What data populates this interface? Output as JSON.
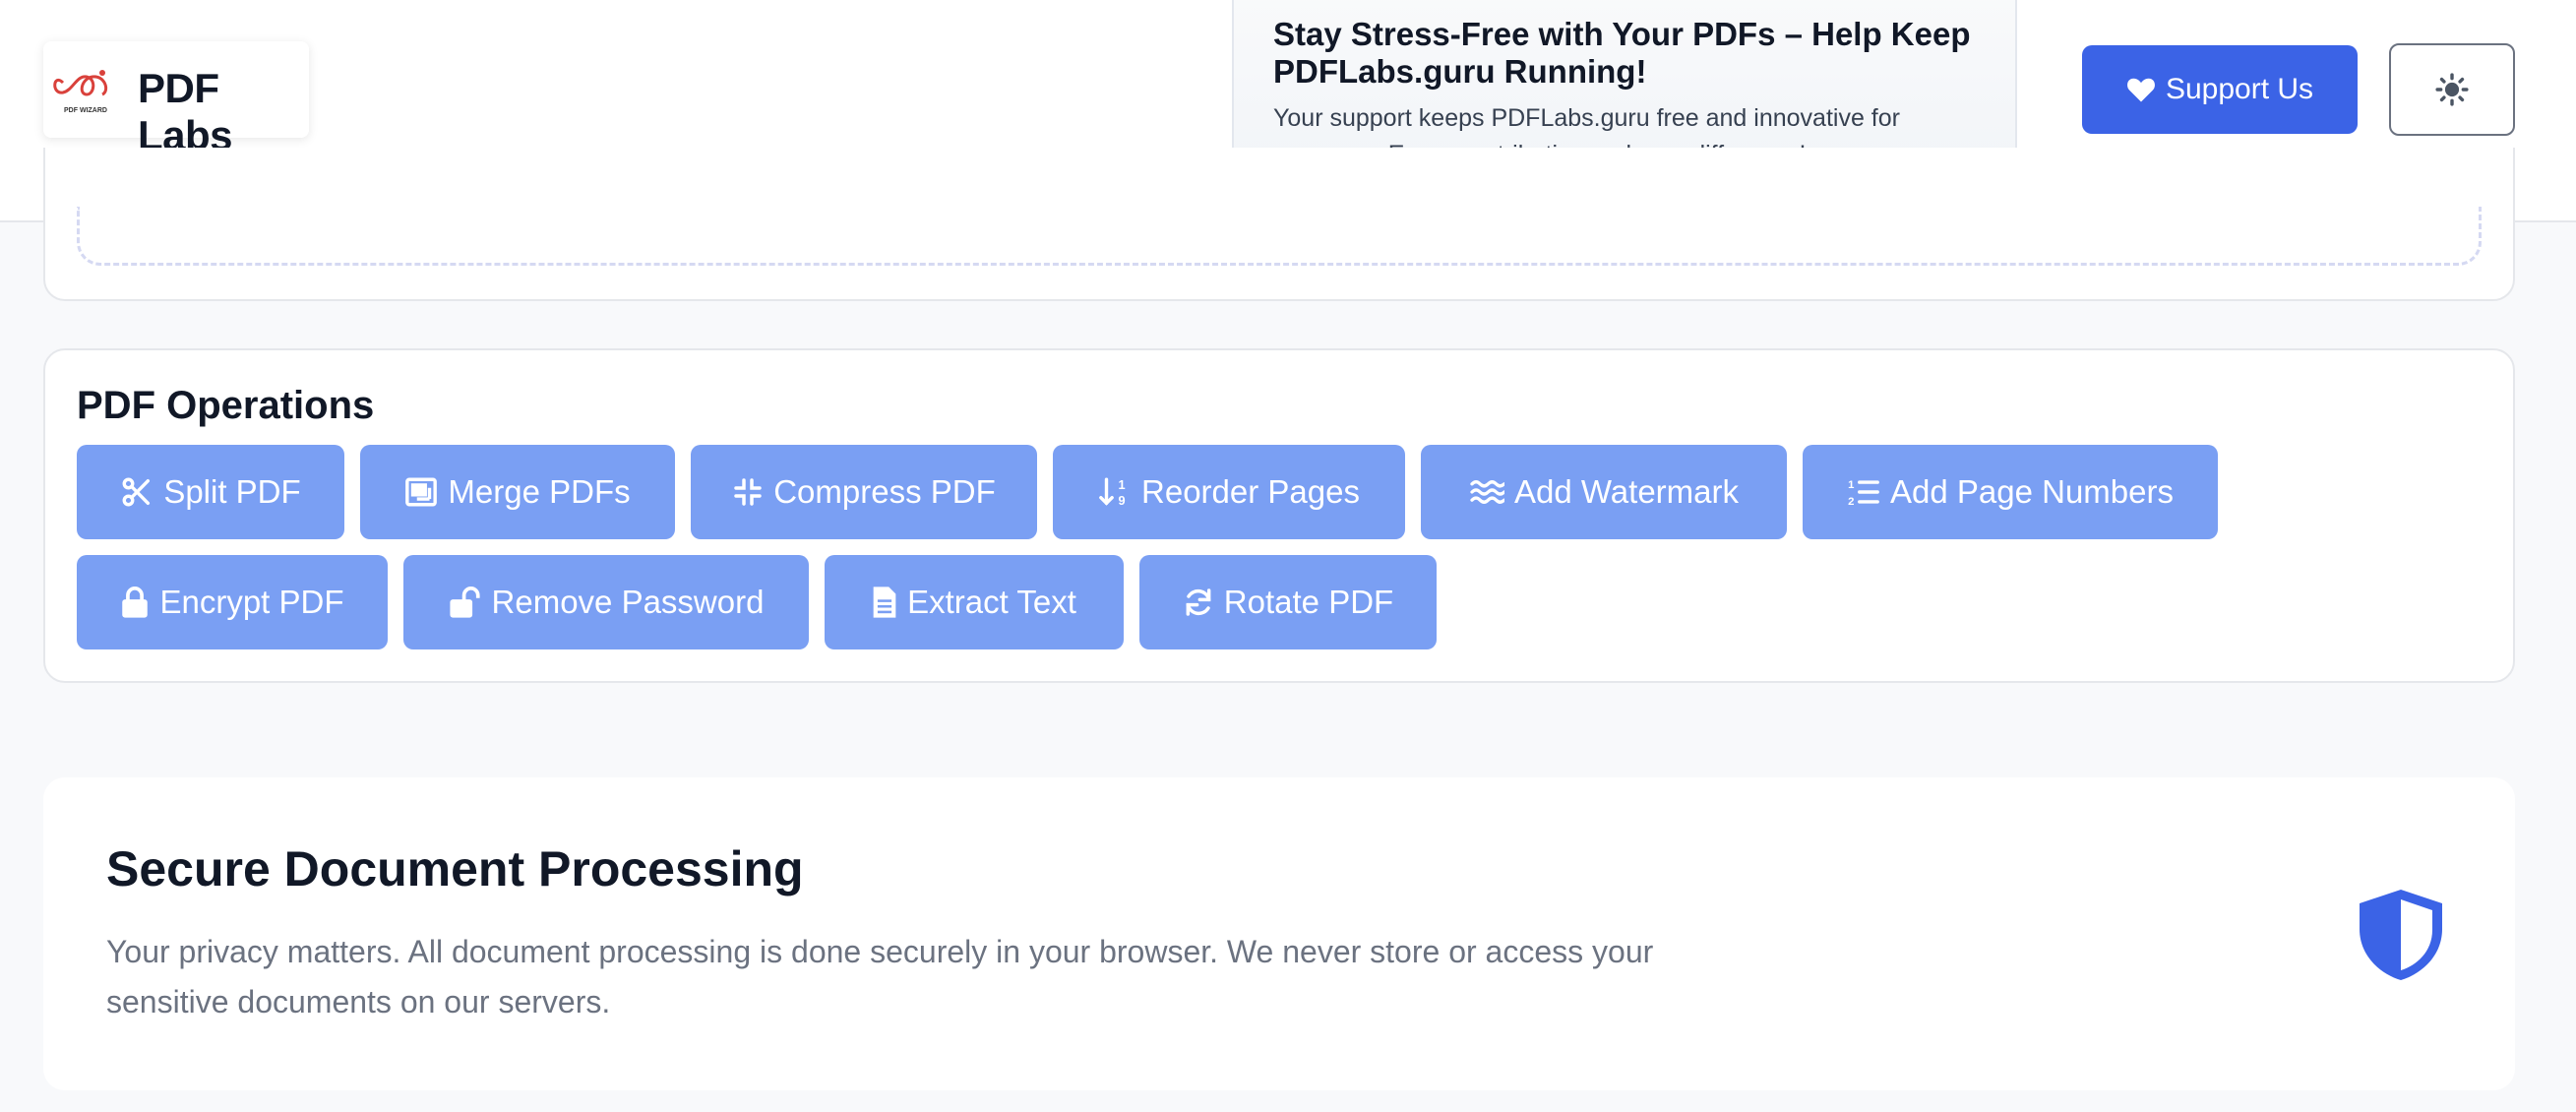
{
  "header": {
    "brand_name": "PDF Labs",
    "logo_caption": "PDF WIZARD",
    "promo": {
      "title": "Stay Stress-Free with Your PDFs – Help Keep PDFLabs.guru Running!",
      "text": "Your support keeps PDFLabs.guru free and innovative for everyone. Every contribution makes a difference!"
    },
    "support_label": "Support Us",
    "theme_toggle_icon": "sun-icon"
  },
  "operations": {
    "title": "PDF Operations",
    "buttons": [
      {
        "label": "Split PDF",
        "icon": "scissors-icon"
      },
      {
        "label": "Merge PDFs",
        "icon": "merge-icon"
      },
      {
        "label": "Compress PDF",
        "icon": "compress-icon"
      },
      {
        "label": "Reorder Pages",
        "icon": "sort-icon"
      },
      {
        "label": "Add Watermark",
        "icon": "water-icon"
      },
      {
        "label": "Add Page Numbers",
        "icon": "numbered-list-icon"
      },
      {
        "label": "Encrypt PDF",
        "icon": "lock-icon"
      },
      {
        "label": "Remove Password",
        "icon": "unlock-icon"
      },
      {
        "label": "Extract Text",
        "icon": "file-text-icon"
      },
      {
        "label": "Rotate PDF",
        "icon": "rotate-icon"
      }
    ]
  },
  "secure": {
    "title": "Secure Document Processing",
    "text": "Your privacy matters. All document processing is done securely in your browser. We never store or access your sensitive documents on our servers.",
    "icon": "shield-icon"
  },
  "colors": {
    "primary": "#3b63e6",
    "operation_button": "#7a9ff3",
    "page_background": "#f8f9fb"
  }
}
